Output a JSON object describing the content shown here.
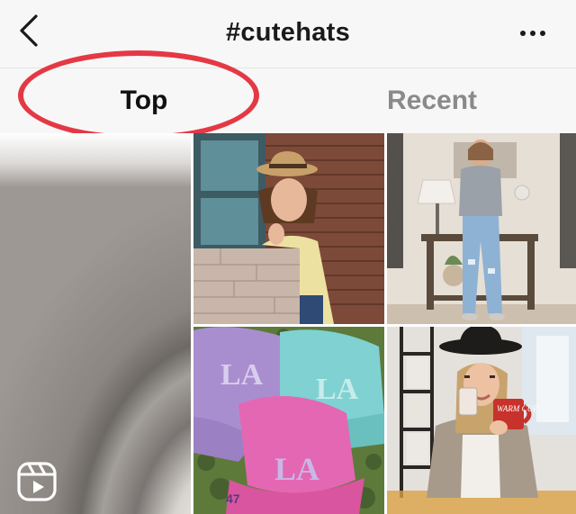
{
  "header": {
    "title": "#cutehats",
    "back_icon": "chevron-left-icon",
    "more_icon": "more-horizontal-icon"
  },
  "tabs": [
    {
      "label": "Top",
      "active": true
    },
    {
      "label": "Recent",
      "active": false
    }
  ],
  "annotation": {
    "shape": "ellipse",
    "color": "#e53845",
    "target": "Top"
  },
  "grid": {
    "tiles": [
      {
        "content": "close-up of a gray hat brim",
        "type": "reel",
        "badge_icon": "reels-icon"
      },
      {
        "content": "woman in tan fedora and yellow cardigan beside brick wall"
      },
      {
        "content": "woman in gray tee and ripped jeans in living room"
      },
      {
        "content": "pile of colored baseball caps with LA logo"
      },
      {
        "content": "woman in black wide-brim hat holding red mug"
      }
    ],
    "cap_texts": [
      "LA",
      "LA",
      "LA",
      "47"
    ],
    "mug_text": "WARM CUP"
  }
}
